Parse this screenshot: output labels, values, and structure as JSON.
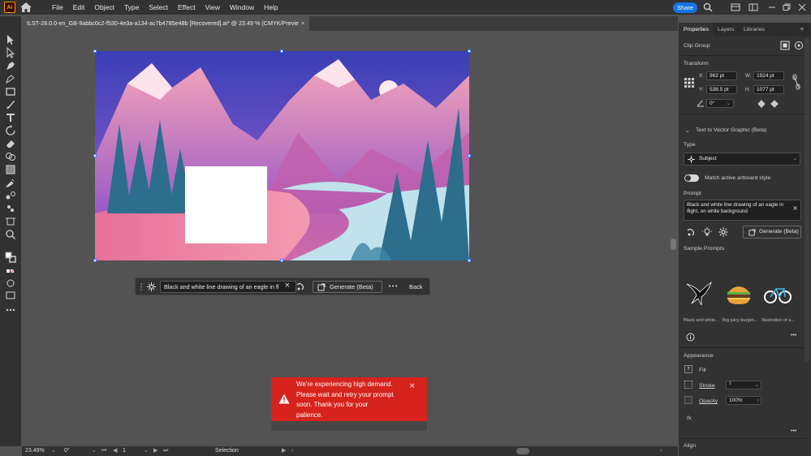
{
  "app": {
    "logo": "Ai"
  },
  "menu": [
    "File",
    "Edit",
    "Object",
    "Type",
    "Select",
    "Effect",
    "View",
    "Window",
    "Help"
  ],
  "share_label": "Share",
  "document_tab": {
    "title": "ILST-28.0.0-en_GB-9abbc0c2-f530-4e3a-a134-ac7b4785e48b [Recovered].ai* @ 23.49 % (CMYK/Previe",
    "close": "×"
  },
  "context_bar": {
    "prompt": "Black and white line drawing of an eagle in fl",
    "clear": "×",
    "generate_label": "Generate (Beta)",
    "more": "•••",
    "back_label": "Back"
  },
  "toast": {
    "message": "We're experiencing high demand. Please wait and retry your prompt soon. Thank you for your patience.",
    "close": "×",
    "color": "#d7231d"
  },
  "statusbar": {
    "zoom": "23.49%",
    "rotation": "0°",
    "artboard": "1",
    "tool": "Selection"
  },
  "panel": {
    "tabs": [
      "Properties",
      "Layers",
      "Libraries"
    ],
    "selection_type": "Clip Group",
    "transform": {
      "title": "Transform",
      "x_label": "X:",
      "x": "962 pt",
      "y_label": "Y:",
      "y": "538.5 pt",
      "w_label": "W:",
      "w": "1924 pt",
      "h_label": "H:",
      "h": "1077 pt",
      "angle": "0°"
    },
    "t2v": {
      "title": "Text to Vector Graphic (Beta)",
      "type_label": "Type",
      "type_value": "Subject",
      "match_label": "Match active artboard style",
      "prompt_label": "Prompt",
      "prompt_value": "Black and white line drawing of an eagle in flight, on white background",
      "generate_label": "Generate (Beta)",
      "samples_label": "Sample Prompts",
      "samples": [
        "Black and white...",
        "Big juicy burger...",
        "Illustration of a..."
      ]
    },
    "appearance": {
      "title": "Appearance",
      "fill_label": "Fill",
      "stroke_label": "Stroke",
      "opacity_label": "Opacity",
      "opacity_value": "100%",
      "fx": "fx."
    },
    "align_title": "Align"
  },
  "colors": {
    "accent": "#1473e6",
    "error": "#d7231d",
    "chrome": "#323232",
    "canvas": "#535353"
  }
}
